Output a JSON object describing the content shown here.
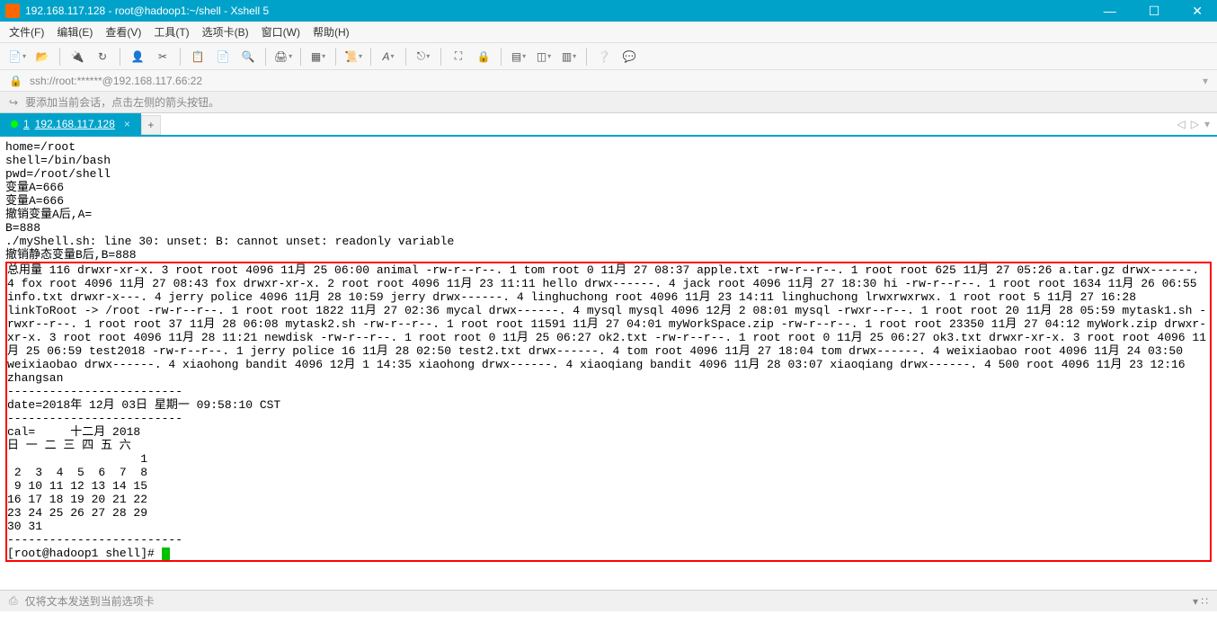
{
  "titlebar": {
    "title": "192.168.117.128 - root@hadoop1:~/shell - Xshell 5"
  },
  "menubar": {
    "items": [
      "文件(F)",
      "编辑(E)",
      "查看(V)",
      "工具(T)",
      "选项卡(B)",
      "窗口(W)",
      "帮助(H)"
    ]
  },
  "addressbar": {
    "url": "ssh://root:******@192.168.117.66:22"
  },
  "infobar": {
    "tip": "要添加当前会话，点击左侧的箭头按钮。"
  },
  "tab": {
    "prefix": "1",
    "label": "192.168.117.128"
  },
  "terminal": {
    "pre_lines": "home=/root\nshell=/bin/bash\npwd=/root/shell\n变量A=666\n变量A=666\n撤销变量A后,A=\nB=888\n./myShell.sh: line 30: unset: B: cannot unset: readonly variable\n撤销静态变量B后,B=888",
    "red_lines": "总用量 116 drwxr-xr-x. 3 root root 4096 11月 25 06:00 animal -rw-r--r--. 1 tom root 0 11月 27 08:37 apple.txt -rw-r--r--. 1 root root 625 11月 27 05:26 a.tar.gz drwx------. 4 fox root 4096 11月 27 08:43 fox drwxr-xr-x. 2 root root 4096 11月 23 11:11 hello drwx------. 4 jack root 4096 11月 27 18:30 hi -rw-r--r--. 1 root root 1634 11月 26 06:55 info.txt drwxr-x---. 4 jerry police 4096 11月 28 10:59 jerry drwx------. 4 linghuchong root 4096 11月 23 14:11 linghuchong lrwxrwxrwx. 1 root root 5 11月 27 16:28 linkToRoot -> /root -rw-r--r--. 1 root root 1822 11月 27 02:36 mycal drwx------. 4 mysql mysql 4096 12月 2 08:01 mysql -rwxr--r--. 1 root root 20 11月 28 05:59 mytask1.sh -rwxr--r--. 1 root root 37 11月 28 06:08 mytask2.sh -rw-r--r--. 1 root root 11591 11月 27 04:01 myWorkSpace.zip -rw-r--r--. 1 root root 23350 11月 27 04:12 myWork.zip drwxr-xr-x. 3 root root 4096 11月 28 11:21 newdisk -rw-r--r--. 1 root root 0 11月 25 06:27 ok2.txt -rw-r--r--. 1 root root 0 11月 25 06:27 ok3.txt drwxr-xr-x. 3 root root 4096 11月 25 06:59 test2018 -rw-r--r--. 1 jerry police 16 11月 28 02:50 test2.txt drwx------. 4 tom root 4096 11月 27 18:04 tom drwx------. 4 weixiaobao root 4096 11月 24 03:50 weixiaobao drwx------. 4 xiaohong bandit 4096 12月 1 14:35 xiaohong drwx------. 4 xiaoqiang bandit 4096 11月 28 03:07 xiaoqiang drwx------. 4 500 root 4096 11月 23 12:16 zhangsan\n-------------------------\ndate=2018年 12月 03日 星期一 09:58:10 CST\n-------------------------\ncal=     十二月 2018\n日 一 二 三 四 五 六\n                   1\n 2  3  4  5  6  7  8\n 9 10 11 12 13 14 15\n16 17 18 19 20 21 22\n23 24 25 26 27 28 29\n30 31\n-------------------------",
    "prompt": "[root@hadoop1 shell]# "
  },
  "statusbar": {
    "text": "仅将文本发送到当前选项卡"
  }
}
